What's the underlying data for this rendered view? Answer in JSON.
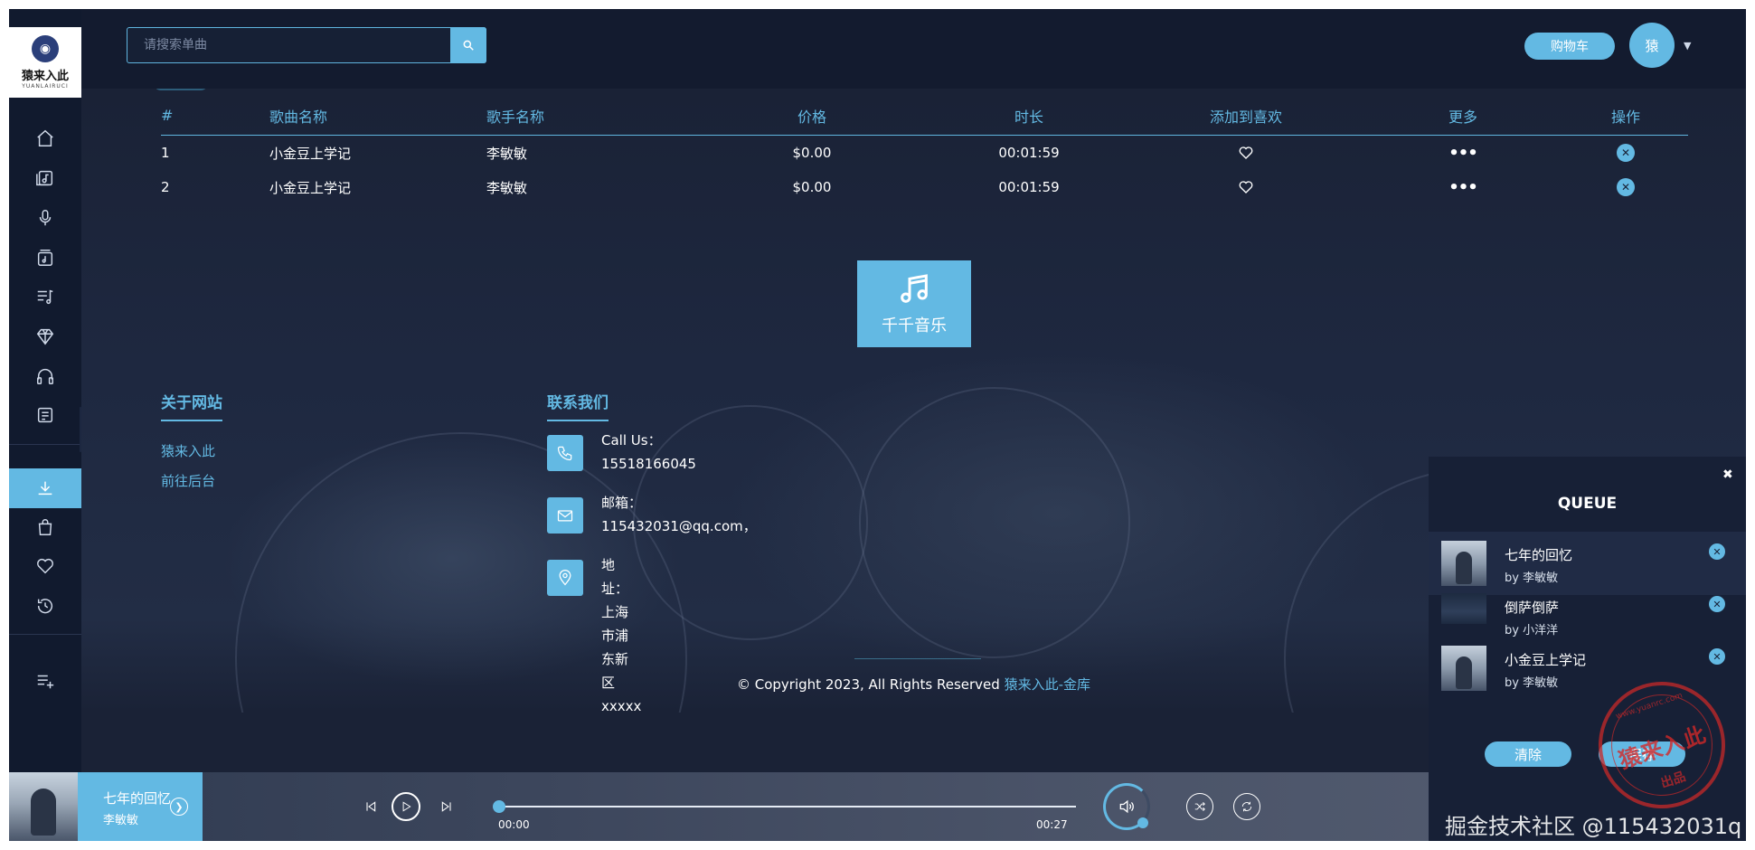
{
  "brand": {
    "logo_text": "猿来入此",
    "logo_sub": "YUANLAIRUCI"
  },
  "search": {
    "placeholder": "请搜索单曲"
  },
  "header": {
    "cart_label": "购物车",
    "avatar_text": "猿"
  },
  "sidebar": {
    "items": [
      {
        "icon": "home-icon"
      },
      {
        "icon": "music-library-icon"
      },
      {
        "icon": "microphone-icon"
      },
      {
        "icon": "album-icon"
      },
      {
        "icon": "playlist-icon"
      },
      {
        "icon": "diamond-icon"
      },
      {
        "icon": "headphones-icon"
      },
      {
        "icon": "document-icon"
      },
      {
        "icon": "download-icon",
        "active": true
      },
      {
        "icon": "shopping-bag-icon"
      },
      {
        "icon": "heart-icon"
      },
      {
        "icon": "history-icon"
      },
      {
        "icon": "add-to-playlist-icon"
      }
    ]
  },
  "table": {
    "headers": [
      "#",
      "歌曲名称",
      "歌手名称",
      "价格",
      "时长",
      "添加到喜欢",
      "更多",
      "操作"
    ],
    "rows": [
      {
        "num": "1",
        "name": "小金豆上学记",
        "singer": "李敏敏",
        "price": "$0.00",
        "duration": "00:01:59"
      },
      {
        "num": "2",
        "name": "小金豆上学记",
        "singer": "李敏敏",
        "price": "$0.00",
        "duration": "00:01:59"
      }
    ],
    "more_glyph": "•••"
  },
  "brand_tile": {
    "label": "千千音乐"
  },
  "footer": {
    "about_title": "关于网站",
    "about_links": [
      "猿来入此",
      "前往后台"
    ],
    "contact_title": "联系我们",
    "contacts": [
      {
        "icon": "phone-icon",
        "label": "Call Us：",
        "value": "15518166045"
      },
      {
        "icon": "mail-icon",
        "label": "邮箱：",
        "value": "115432031@qq.com，"
      },
      {
        "icon": "location-icon",
        "label": "地址：",
        "value": "上海市浦东新区xxxxx"
      }
    ],
    "copyright_prefix": "© Copyright 2023, All Rights Reserved",
    "copyright_link": "猿来入此-金库"
  },
  "player": {
    "title": "七年的回忆",
    "artist": "李敏敏",
    "current_time": "00:00",
    "total_time": "00:27",
    "progress": 0.0
  },
  "queue": {
    "title": "QUEUE",
    "items": [
      {
        "name": "七年的回忆",
        "by": "by 李敏敏"
      },
      {
        "name": "倒萨倒萨",
        "by": "by 小洋洋"
      },
      {
        "name": "小金豆上学记",
        "by": "by 李敏敏"
      }
    ],
    "clear_label": "清除",
    "save_label": "保存"
  },
  "stamp": {
    "text": "猿来入此",
    "sub": "www.yuanrc.com",
    "bottom": "出品"
  },
  "watermark": "掘金技术社区 @115432031q",
  "colors": {
    "accent": "#63b9e3",
    "background": "#1a2236",
    "sidebar": "#111a2e"
  }
}
